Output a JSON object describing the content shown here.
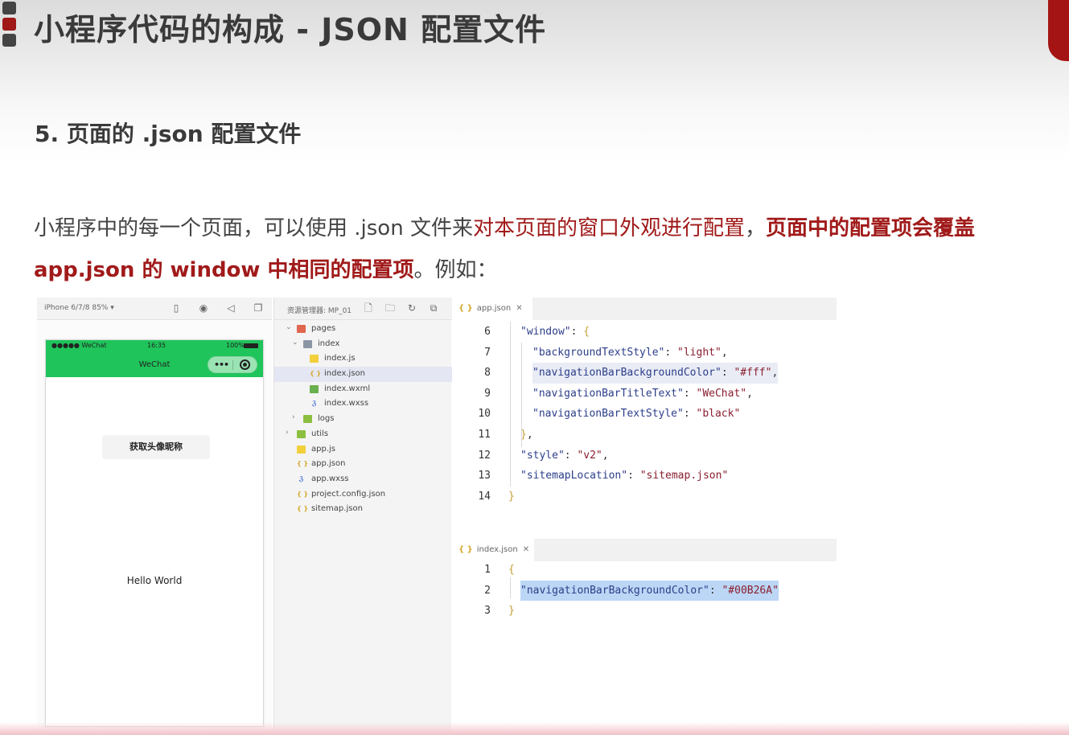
{
  "slide": {
    "title": "小程序代码的构成 - JSON 配置文件",
    "subtitle": "5. 页面的 .json 配置文件",
    "desc": {
      "part1": "小程序中的每一个页面，可以使用 .json 文件来",
      "part2": "对本页面的窗口外观进行配置",
      "part3": "，",
      "part4": "页面中的配置项会覆盖",
      "part5": "app.json 的 window 中相同的配置项",
      "part6": "。例如："
    }
  },
  "simulator": {
    "device_label": "iPhone 6/7/8 85% ▾",
    "status_left": "●●●●● WeChat",
    "status_time": "16:35",
    "status_right": "100%",
    "nav_title": "WeChat",
    "nav_color": "#1fc45a",
    "avatar_button": "获取头像昵称",
    "hello_text": "Hello World"
  },
  "explorer": {
    "title": "资源管理器: MP_01",
    "items": [
      {
        "label": "pages",
        "type": "folder-red",
        "depth": 0,
        "arrow": "⌄"
      },
      {
        "label": "index",
        "type": "folder-gray",
        "depth": 1,
        "arrow": "⌄"
      },
      {
        "label": "index.js",
        "type": "js",
        "depth": 2,
        "arrow": ""
      },
      {
        "label": "index.json",
        "type": "json",
        "depth": 2,
        "arrow": "",
        "selected": true
      },
      {
        "label": "index.wxml",
        "type": "wxml",
        "depth": 2,
        "arrow": ""
      },
      {
        "label": "index.wxss",
        "type": "wxss",
        "depth": 2,
        "arrow": ""
      },
      {
        "label": "logs",
        "type": "folder-green",
        "depth": 1,
        "arrow": "›"
      },
      {
        "label": "utils",
        "type": "folder-green",
        "depth": 0,
        "arrow": "›"
      },
      {
        "label": "app.js",
        "type": "js",
        "depth": 0,
        "arrow": ""
      },
      {
        "label": "app.json",
        "type": "json",
        "depth": 0,
        "arrow": ""
      },
      {
        "label": "app.wxss",
        "type": "wxss",
        "depth": 0,
        "arrow": ""
      },
      {
        "label": "project.config.json",
        "type": "json",
        "depth": 0,
        "arrow": ""
      },
      {
        "label": "sitemap.json",
        "type": "json",
        "depth": 0,
        "arrow": ""
      }
    ]
  },
  "editor_app": {
    "tab": "app.json",
    "lines": [
      {
        "n": "6",
        "tokens": [
          [
            "k",
            "\"window\""
          ],
          [
            "p",
            ": "
          ],
          [
            "b",
            "{"
          ]
        ],
        "indent": 1
      },
      {
        "n": "7",
        "tokens": [
          [
            "k",
            "\"backgroundTextStyle\""
          ],
          [
            "p",
            ": "
          ],
          [
            "s",
            "\"light\""
          ],
          [
            "p",
            ","
          ]
        ],
        "indent": 2
      },
      {
        "n": "8",
        "tokens": [
          [
            "k",
            "\"navigationBarBackgroundColor\""
          ],
          [
            "p",
            ": "
          ],
          [
            "s",
            "\"#fff\""
          ],
          [
            "p",
            ","
          ]
        ],
        "indent": 2,
        "mark": true
      },
      {
        "n": "9",
        "tokens": [
          [
            "k",
            "\"navigationBarTitleText\""
          ],
          [
            "p",
            ": "
          ],
          [
            "s",
            "\"WeChat\""
          ],
          [
            "p",
            ","
          ]
        ],
        "indent": 2
      },
      {
        "n": "10",
        "tokens": [
          [
            "k",
            "\"navigationBarTextStyle\""
          ],
          [
            "p",
            ": "
          ],
          [
            "s",
            "\"black\""
          ]
        ],
        "indent": 2
      },
      {
        "n": "11",
        "tokens": [
          [
            "b",
            "}"
          ],
          [
            "p",
            ","
          ]
        ],
        "indent": 1
      },
      {
        "n": "12",
        "tokens": [
          [
            "k",
            "\"style\""
          ],
          [
            "p",
            ": "
          ],
          [
            "s",
            "\"v2\""
          ],
          [
            "p",
            ","
          ]
        ],
        "indent": 1
      },
      {
        "n": "13",
        "tokens": [
          [
            "k",
            "\"sitemapLocation\""
          ],
          [
            "p",
            ": "
          ],
          [
            "s",
            "\"sitemap.json\""
          ]
        ],
        "indent": 1
      },
      {
        "n": "14",
        "tokens": [
          [
            "b",
            "}"
          ]
        ],
        "indent": 0
      }
    ]
  },
  "editor_index": {
    "tab": "index.json",
    "lines": [
      {
        "n": "1",
        "tokens": [
          [
            "b",
            "{"
          ]
        ],
        "indent": 0
      },
      {
        "n": "2",
        "tokens": [
          [
            "k",
            "\"navigationBarBackgroundColor\""
          ],
          [
            "p",
            ": "
          ],
          [
            "s",
            "\"#00B26A\""
          ]
        ],
        "indent": 1,
        "select": true
      },
      {
        "n": "3",
        "tokens": [
          [
            "b",
            "}"
          ]
        ],
        "indent": 0
      }
    ]
  },
  "colors": {
    "accent_red": "#a11a1a",
    "wechat_green": "#1fc45a"
  }
}
